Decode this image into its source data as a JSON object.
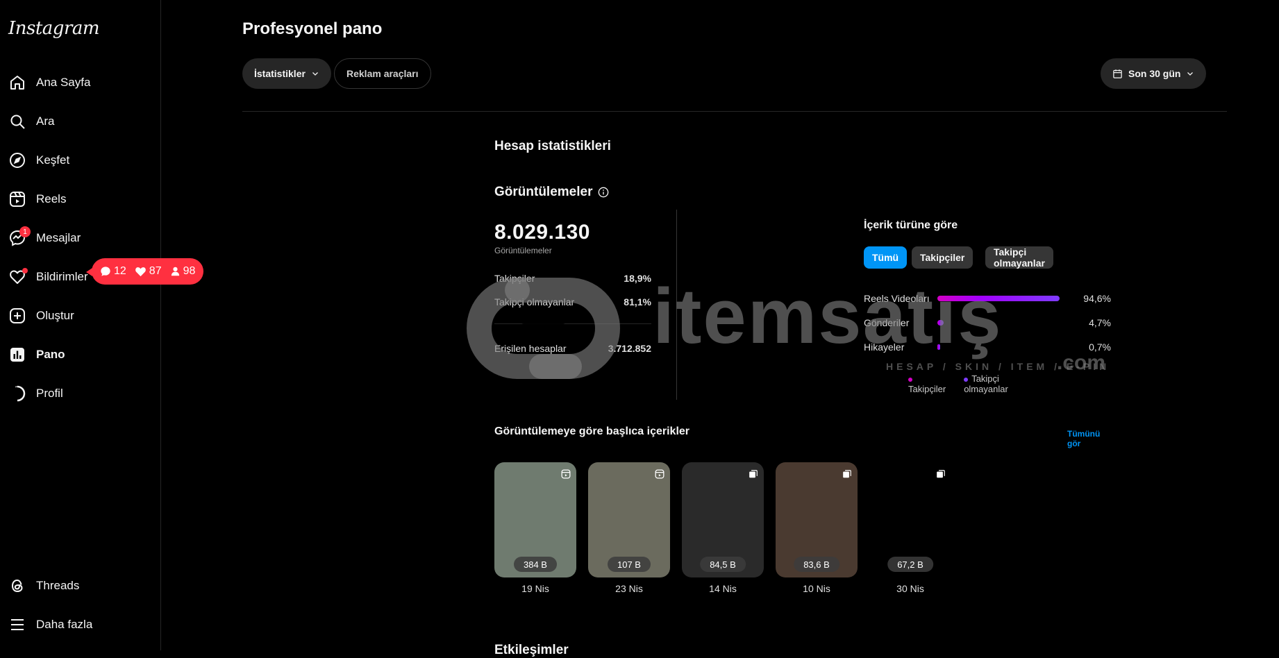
{
  "sidebar": {
    "logo": "Instagram",
    "items": [
      {
        "label": "Ana Sayfa",
        "icon": "home-icon"
      },
      {
        "label": "Ara",
        "icon": "search-icon"
      },
      {
        "label": "Keşfet",
        "icon": "compass-icon"
      },
      {
        "label": "Reels",
        "icon": "reels-icon"
      },
      {
        "label": "Mesajlar",
        "icon": "messenger-icon",
        "badge": "1"
      },
      {
        "label": "Bildirimler",
        "icon": "heart-icon"
      },
      {
        "label": "Oluştur",
        "icon": "plus-square-icon"
      },
      {
        "label": "Pano",
        "icon": "dashboard-icon"
      },
      {
        "label": "Profil",
        "icon": "avatar-icon"
      }
    ],
    "bottom": [
      {
        "label": "Threads",
        "icon": "threads-icon"
      },
      {
        "label": "Daha fazla",
        "icon": "menu-icon"
      }
    ],
    "notification_pill": {
      "comments": "12",
      "likes": "87",
      "follows": "98"
    }
  },
  "header": {
    "title": "Profesyonel pano",
    "tabs": [
      {
        "label": "İstatistikler"
      },
      {
        "label": "Reklam araçları"
      }
    ],
    "date_range": "Son 30 gün"
  },
  "account_stats": {
    "title": "Hesap istatistikleri",
    "views_title": "Görüntülemeler",
    "total": "8.029.130",
    "total_label": "Görüntülemeler",
    "rows": [
      {
        "label": "Takipçiler",
        "value": "18,9%"
      },
      {
        "label": "Takipçi olmayanlar",
        "value": "81,1%"
      }
    ],
    "reach": {
      "label": "Erişilen hesaplar",
      "value": "3.712.852"
    }
  },
  "by_content": {
    "title": "İçerik türüne göre",
    "filters": [
      {
        "label": "Tümü",
        "active": true
      },
      {
        "label": "Takipçiler",
        "active": false
      },
      {
        "label": "Takipçi olmayanlar",
        "active": false
      }
    ],
    "bars": [
      {
        "label": "Reels Videoları",
        "value": "94,6%",
        "fraction": 0.946
      },
      {
        "label": "Gönderiler",
        "value": "4,7%",
        "fraction": 0.047
      },
      {
        "label": "Hikayeler",
        "value": "0,7%",
        "fraction": 0.007
      }
    ],
    "legend": [
      {
        "label": "Takipçiler",
        "color": "#d300c5"
      },
      {
        "label": "Takipçi olmayanlar",
        "color": "#7f3cff"
      }
    ]
  },
  "top_content": {
    "title": "Görüntülemeye göre başlıca içerikler",
    "see_all": "Tümünü gör",
    "items": [
      {
        "views": "384 B",
        "date": "19 Nis",
        "type": "reels-icon",
        "bg": "#6f7b6f"
      },
      {
        "views": "107 B",
        "date": "23 Nis",
        "type": "reels-icon",
        "bg": "#6b6b5e"
      },
      {
        "views": "84,5 B",
        "date": "14 Nis",
        "type": "carousel-icon",
        "bg": "#2a2a2a"
      },
      {
        "views": "83,6 B",
        "date": "10 Nis",
        "type": "carousel-icon",
        "bg": "#4a3a30"
      },
      {
        "views": "67,2 B",
        "date": "30 Nis",
        "type": "carousel-icon",
        "bg": "#000000"
      }
    ]
  },
  "interactions_title": "Etkileşimler",
  "watermark": {
    "text": "itemsatış",
    "sub": "HESAP / SKIN / ITEM / E-PIN",
    "domain": ".com"
  }
}
